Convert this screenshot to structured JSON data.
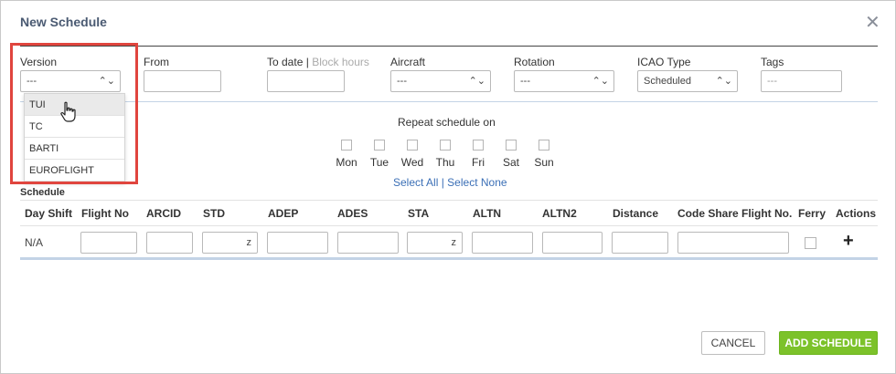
{
  "dialog": {
    "title": "New Schedule",
    "close_icon": "close-icon"
  },
  "fields": {
    "version": {
      "label": "Version",
      "value": "---"
    },
    "from": {
      "label": "From"
    },
    "to_date": {
      "label": "To date",
      "separator": "|",
      "alt_label": "Block hours"
    },
    "aircraft": {
      "label": "Aircraft",
      "value": "---"
    },
    "rotation": {
      "label": "Rotation",
      "value": "---"
    },
    "icao_type": {
      "label": "ICAO Type",
      "value": "Scheduled"
    },
    "tags": {
      "label": "Tags",
      "placeholder": "---"
    }
  },
  "version_dropdown": {
    "options": [
      "TUI",
      "TC",
      "BARTI",
      "EUROFLIGHT"
    ],
    "hovered": "TUI"
  },
  "repeat": {
    "title": "Repeat schedule on",
    "days": [
      "Mon",
      "Tue",
      "Wed",
      "Thu",
      "Fri",
      "Sat",
      "Sun"
    ],
    "select_all": "Select All",
    "separator": "|",
    "select_none": "Select None"
  },
  "schedule": {
    "section_label": "Schedule",
    "columns": [
      "Day Shift",
      "Flight No",
      "ARCID",
      "STD",
      "ADEP",
      "ADES",
      "STA",
      "ALTN",
      "ALTN2",
      "Distance",
      "Code Share Flight No.",
      "Ferry",
      "Actions"
    ],
    "row": {
      "day_shift": "N/A",
      "std_suffix": "z",
      "sta_suffix": "z"
    },
    "add_icon": "plus-icon"
  },
  "footer": {
    "cancel_label": "CANCEL",
    "add_label": "ADD SCHEDULE"
  },
  "colors": {
    "title": "#4a5a72",
    "link": "#3b6fb6",
    "primary_button": "#7cc22a",
    "highlight_box": "#e0453e",
    "divider_blue": "#c3d3e6"
  }
}
